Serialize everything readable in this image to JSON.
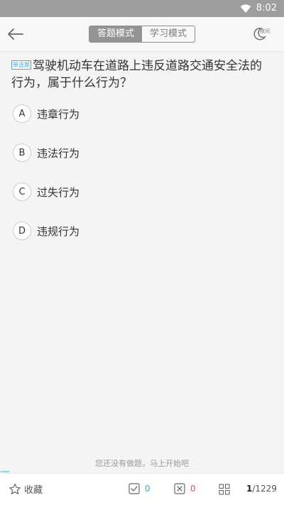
{
  "status_bar": {
    "time": "8:02"
  },
  "header": {
    "modes": [
      {
        "label": "答题模式",
        "active": true
      },
      {
        "label": "学习模式",
        "active": false
      }
    ],
    "night_label": "夜间"
  },
  "question": {
    "type_badge": "单选题",
    "text": "驾驶机动车在道路上违反道路交通安全法的行为，属于什么行为？",
    "options": [
      {
        "letter": "A",
        "text": "违章行为"
      },
      {
        "letter": "B",
        "text": "违法行为"
      },
      {
        "letter": "C",
        "text": "过失行为"
      },
      {
        "letter": "D",
        "text": "违规行为"
      }
    ]
  },
  "hint": "您还没有做题，马上开始吧",
  "bottom_bar": {
    "favorite_label": "收藏",
    "correct_count": "0",
    "wrong_count": "0",
    "current": "1",
    "total": "/1229"
  },
  "colors": {
    "accent_blue": "#2fa8e0",
    "accent_red": "#e0524b",
    "mode_active_bg": "#939393",
    "status_bar_bg": "#9e9e9e",
    "page_bg": "#f4f4f4"
  },
  "icons": {
    "wifi": "wifi-icon",
    "back": "arrow-left-icon",
    "night": "moon-icon",
    "favorite": "star-icon",
    "correct": "check-square-icon",
    "wrong": "x-square-icon",
    "grid": "grid-icon"
  }
}
